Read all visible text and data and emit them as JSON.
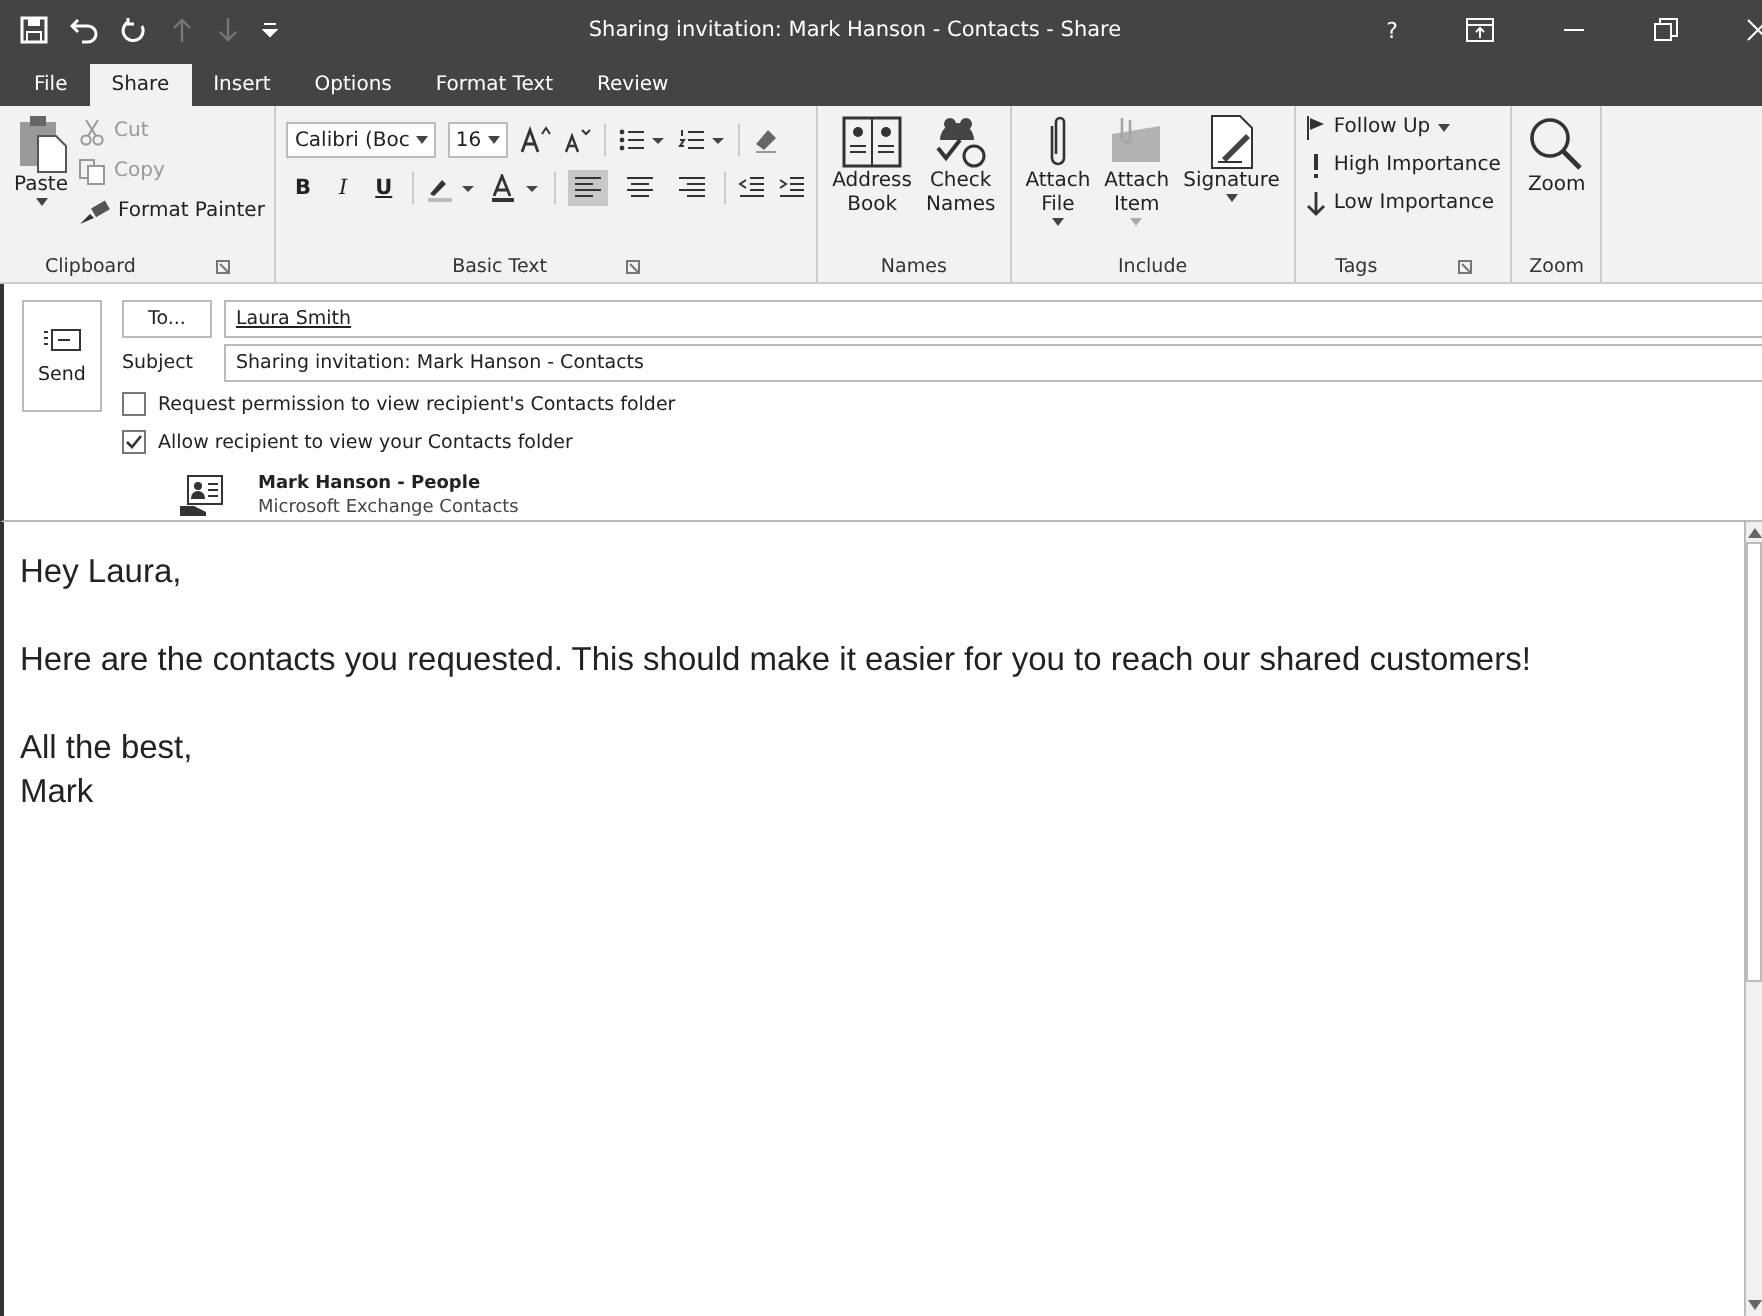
{
  "window": {
    "title": "Sharing invitation: Mark Hanson - Contacts  -  Share",
    "help": "?"
  },
  "tabs": [
    {
      "label": "File",
      "selected": false
    },
    {
      "label": "Share",
      "selected": true
    },
    {
      "label": "Insert",
      "selected": false
    },
    {
      "label": "Options",
      "selected": false
    },
    {
      "label": "Format Text",
      "selected": false
    },
    {
      "label": "Review",
      "selected": false
    }
  ],
  "ribbon": {
    "clipboard": {
      "label": "Clipboard",
      "paste": "Paste",
      "items": [
        {
          "label": "Cut",
          "disabled": true
        },
        {
          "label": "Copy",
          "disabled": true
        },
        {
          "label": "Format Painter",
          "disabled": false
        }
      ]
    },
    "basic_text": {
      "label": "Basic Text",
      "font": "Calibri (Boc",
      "size": "16",
      "styles": [
        "B",
        "I",
        "U"
      ],
      "align": [
        {
          "selected": true
        },
        {
          "selected": false
        },
        {
          "selected": false
        }
      ]
    },
    "names": {
      "label": "Names",
      "buttons": [
        {
          "lines": [
            "Address",
            "Book"
          ]
        },
        {
          "lines": [
            "Check",
            "Names"
          ]
        }
      ]
    },
    "include": {
      "label": "Include",
      "buttons": [
        {
          "lines": [
            "Attach",
            "File"
          ],
          "disabled": false
        },
        {
          "lines": [
            "Attach",
            "Item"
          ],
          "disabled": true
        },
        {
          "lines": [
            "Signature"
          ],
          "disabled": false
        }
      ]
    },
    "tags": {
      "label": "Tags",
      "items": [
        "Follow Up",
        "High Importance",
        "Low Importance"
      ]
    },
    "zoom": {
      "label": "Zoom",
      "button": "Zoom"
    }
  },
  "message": {
    "send": "Send",
    "to_button": "To...",
    "to": "Laura Smith",
    "subject_label": "Subject",
    "subject": "Sharing invitation: Mark Hanson - Contacts",
    "options": [
      {
        "label": "Request permission to view recipient's Contacts folder",
        "checked": false
      },
      {
        "label": "Allow recipient to view your Contacts folder",
        "checked": true
      }
    ],
    "attachment": {
      "name": "Mark Hanson - People",
      "source": "Microsoft Exchange Contacts"
    }
  },
  "body": [
    [
      "Hey Laura,"
    ],
    [
      "Here are the contacts you requested. This should make it easier for you to reach our shared customers!"
    ],
    [
      "All the best,",
      "Mark"
    ]
  ]
}
